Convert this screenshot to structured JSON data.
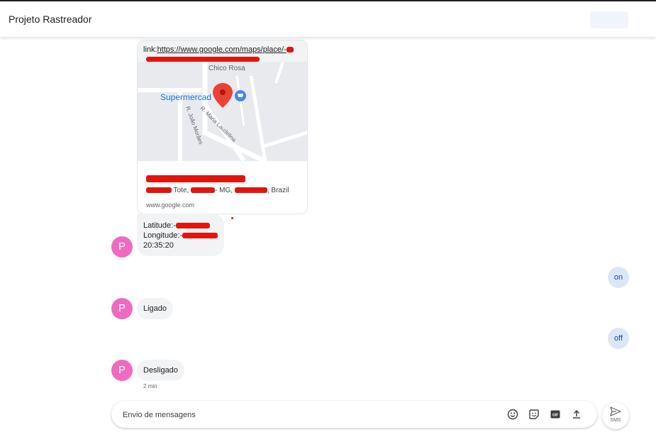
{
  "header": {
    "title": "Projeto Rastreador"
  },
  "map_card": {
    "link_prefix": "link:",
    "link_url": "https://www.google.com/maps/place/-",
    "map_labels": {
      "top": "Chico Rosa",
      "poi": "Supermercad",
      "street1": "R. Maria Laudelina",
      "street2": "R. João Morães"
    },
    "address_suffix1": "Tote,",
    "address_suffix2": "- MG,",
    "address_suffix3": ", Brazil",
    "site": "www.google.com"
  },
  "messages": {
    "coords": {
      "lat_label": "Latitude:-",
      "lon_label": "Longitude:-",
      "time": "20:35:20"
    },
    "avatar_letter": "P",
    "out_on": "on",
    "in_ligado": "Ligado",
    "out_off": "off",
    "in_desligado": "Desligado",
    "timestamp": "2 min"
  },
  "composer": {
    "placeholder": "Envio de mensagens",
    "send_label": "SMS",
    "icons": [
      "emoji-icon",
      "sticker-icon",
      "gif-icon",
      "upload-icon",
      "send-icon"
    ]
  },
  "colors": {
    "avatar": "#f06bbf",
    "outgoing_bubble": "#dbe7f8",
    "incoming_bubble": "#f1f3f4",
    "map_pin": "#ea4335",
    "redaction": "#e3140c"
  }
}
